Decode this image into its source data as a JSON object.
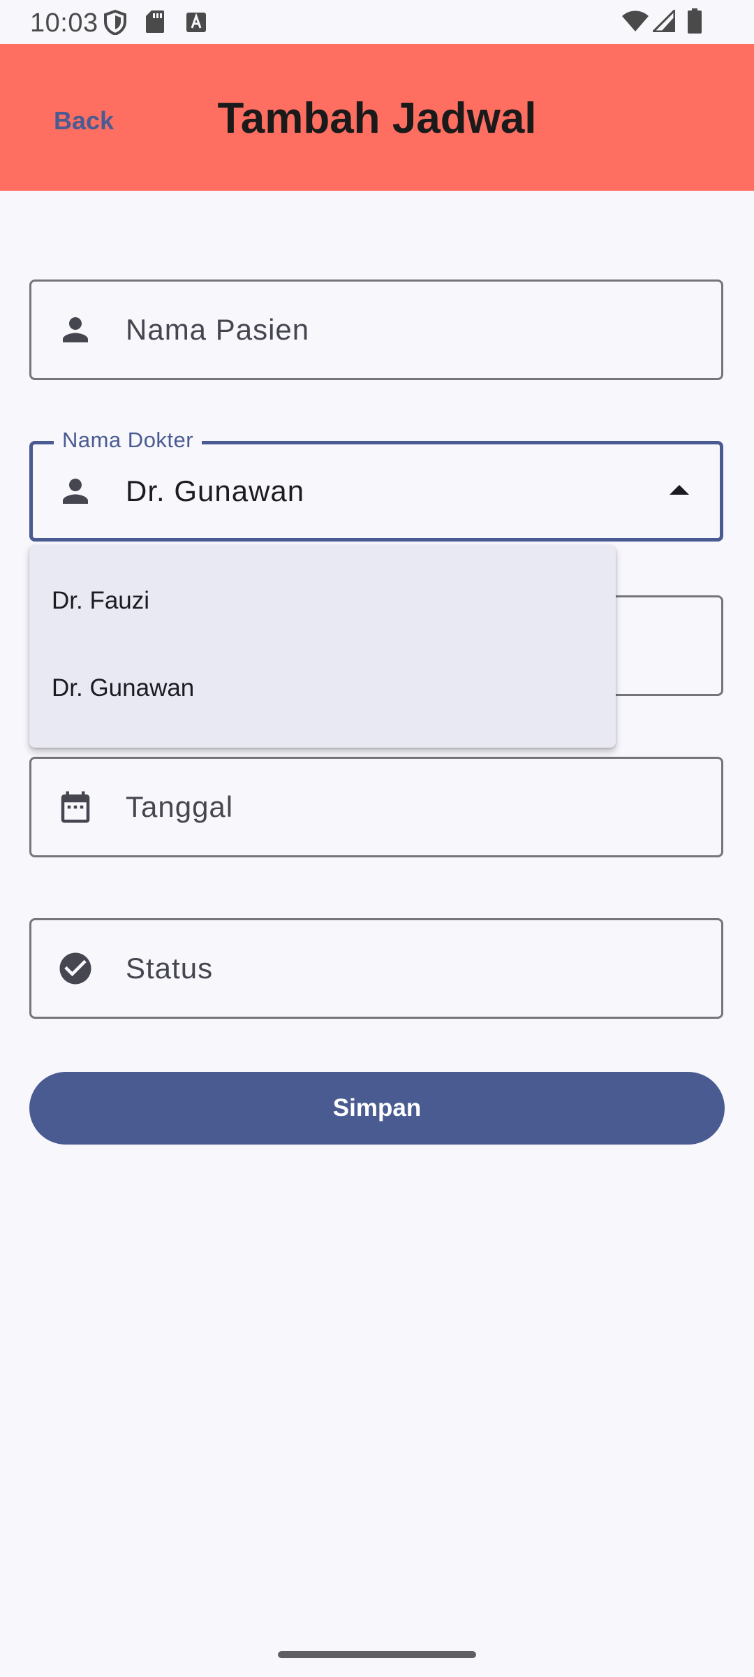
{
  "status_bar": {
    "time": "10:03",
    "left_icons": [
      "shield-icon",
      "sd-card-icon",
      "font-a-icon"
    ],
    "right_icons": [
      "wifi-icon",
      "signal-icon",
      "battery-icon"
    ]
  },
  "app_bar": {
    "back_label": "Back",
    "title": "Tambah Jadwal",
    "background": "#FF6F61"
  },
  "form": {
    "patient_name": {
      "placeholder": "Nama Pasien",
      "icon": "person-icon"
    },
    "doctor_name": {
      "label": "Nama Dokter",
      "value": "Dr. Gunawan",
      "icon": "person-icon",
      "expanded": true,
      "options": [
        "Dr. Fauzi",
        "Dr. Gunawan"
      ]
    },
    "date": {
      "placeholder": "Tanggal",
      "icon": "calendar-icon"
    },
    "status": {
      "placeholder": "Status",
      "icon": "check-circle-icon"
    },
    "save_label": "Simpan"
  },
  "colors": {
    "primary": "#4A5B92",
    "app_bar": "#FF6F61",
    "background": "#F8F7FC",
    "menu_background": "#E9E9F3"
  }
}
